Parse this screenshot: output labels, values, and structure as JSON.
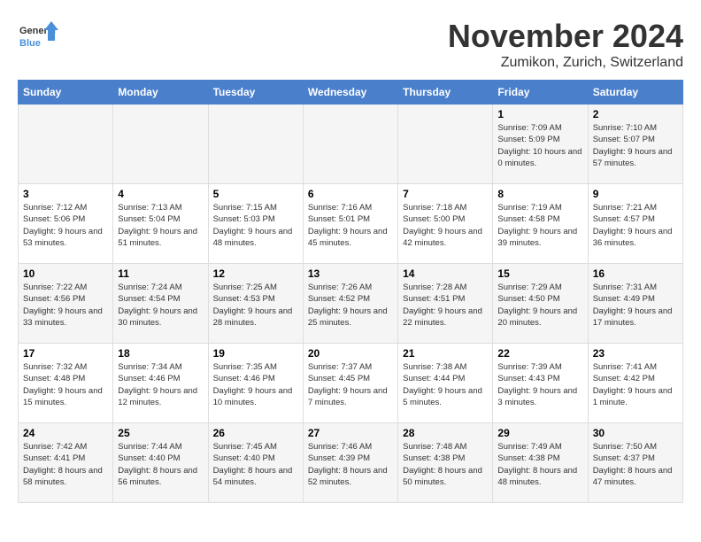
{
  "logo": {
    "line1": "General",
    "line2": "Blue"
  },
  "title": "November 2024",
  "subtitle": "Zumikon, Zurich, Switzerland",
  "days_header": [
    "Sunday",
    "Monday",
    "Tuesday",
    "Wednesday",
    "Thursday",
    "Friday",
    "Saturday"
  ],
  "weeks": [
    [
      {
        "day": "",
        "info": ""
      },
      {
        "day": "",
        "info": ""
      },
      {
        "day": "",
        "info": ""
      },
      {
        "day": "",
        "info": ""
      },
      {
        "day": "",
        "info": ""
      },
      {
        "day": "1",
        "info": "Sunrise: 7:09 AM\nSunset: 5:09 PM\nDaylight: 10 hours and 0 minutes."
      },
      {
        "day": "2",
        "info": "Sunrise: 7:10 AM\nSunset: 5:07 PM\nDaylight: 9 hours and 57 minutes."
      }
    ],
    [
      {
        "day": "3",
        "info": "Sunrise: 7:12 AM\nSunset: 5:06 PM\nDaylight: 9 hours and 53 minutes."
      },
      {
        "day": "4",
        "info": "Sunrise: 7:13 AM\nSunset: 5:04 PM\nDaylight: 9 hours and 51 minutes."
      },
      {
        "day": "5",
        "info": "Sunrise: 7:15 AM\nSunset: 5:03 PM\nDaylight: 9 hours and 48 minutes."
      },
      {
        "day": "6",
        "info": "Sunrise: 7:16 AM\nSunset: 5:01 PM\nDaylight: 9 hours and 45 minutes."
      },
      {
        "day": "7",
        "info": "Sunrise: 7:18 AM\nSunset: 5:00 PM\nDaylight: 9 hours and 42 minutes."
      },
      {
        "day": "8",
        "info": "Sunrise: 7:19 AM\nSunset: 4:58 PM\nDaylight: 9 hours and 39 minutes."
      },
      {
        "day": "9",
        "info": "Sunrise: 7:21 AM\nSunset: 4:57 PM\nDaylight: 9 hours and 36 minutes."
      }
    ],
    [
      {
        "day": "10",
        "info": "Sunrise: 7:22 AM\nSunset: 4:56 PM\nDaylight: 9 hours and 33 minutes."
      },
      {
        "day": "11",
        "info": "Sunrise: 7:24 AM\nSunset: 4:54 PM\nDaylight: 9 hours and 30 minutes."
      },
      {
        "day": "12",
        "info": "Sunrise: 7:25 AM\nSunset: 4:53 PM\nDaylight: 9 hours and 28 minutes."
      },
      {
        "day": "13",
        "info": "Sunrise: 7:26 AM\nSunset: 4:52 PM\nDaylight: 9 hours and 25 minutes."
      },
      {
        "day": "14",
        "info": "Sunrise: 7:28 AM\nSunset: 4:51 PM\nDaylight: 9 hours and 22 minutes."
      },
      {
        "day": "15",
        "info": "Sunrise: 7:29 AM\nSunset: 4:50 PM\nDaylight: 9 hours and 20 minutes."
      },
      {
        "day": "16",
        "info": "Sunrise: 7:31 AM\nSunset: 4:49 PM\nDaylight: 9 hours and 17 minutes."
      }
    ],
    [
      {
        "day": "17",
        "info": "Sunrise: 7:32 AM\nSunset: 4:48 PM\nDaylight: 9 hours and 15 minutes."
      },
      {
        "day": "18",
        "info": "Sunrise: 7:34 AM\nSunset: 4:46 PM\nDaylight: 9 hours and 12 minutes."
      },
      {
        "day": "19",
        "info": "Sunrise: 7:35 AM\nSunset: 4:46 PM\nDaylight: 9 hours and 10 minutes."
      },
      {
        "day": "20",
        "info": "Sunrise: 7:37 AM\nSunset: 4:45 PM\nDaylight: 9 hours and 7 minutes."
      },
      {
        "day": "21",
        "info": "Sunrise: 7:38 AM\nSunset: 4:44 PM\nDaylight: 9 hours and 5 minutes."
      },
      {
        "day": "22",
        "info": "Sunrise: 7:39 AM\nSunset: 4:43 PM\nDaylight: 9 hours and 3 minutes."
      },
      {
        "day": "23",
        "info": "Sunrise: 7:41 AM\nSunset: 4:42 PM\nDaylight: 9 hours and 1 minute."
      }
    ],
    [
      {
        "day": "24",
        "info": "Sunrise: 7:42 AM\nSunset: 4:41 PM\nDaylight: 8 hours and 58 minutes."
      },
      {
        "day": "25",
        "info": "Sunrise: 7:44 AM\nSunset: 4:40 PM\nDaylight: 8 hours and 56 minutes."
      },
      {
        "day": "26",
        "info": "Sunrise: 7:45 AM\nSunset: 4:40 PM\nDaylight: 8 hours and 54 minutes."
      },
      {
        "day": "27",
        "info": "Sunrise: 7:46 AM\nSunset: 4:39 PM\nDaylight: 8 hours and 52 minutes."
      },
      {
        "day": "28",
        "info": "Sunrise: 7:48 AM\nSunset: 4:38 PM\nDaylight: 8 hours and 50 minutes."
      },
      {
        "day": "29",
        "info": "Sunrise: 7:49 AM\nSunset: 4:38 PM\nDaylight: 8 hours and 48 minutes."
      },
      {
        "day": "30",
        "info": "Sunrise: 7:50 AM\nSunset: 4:37 PM\nDaylight: 8 hours and 47 minutes."
      }
    ]
  ]
}
